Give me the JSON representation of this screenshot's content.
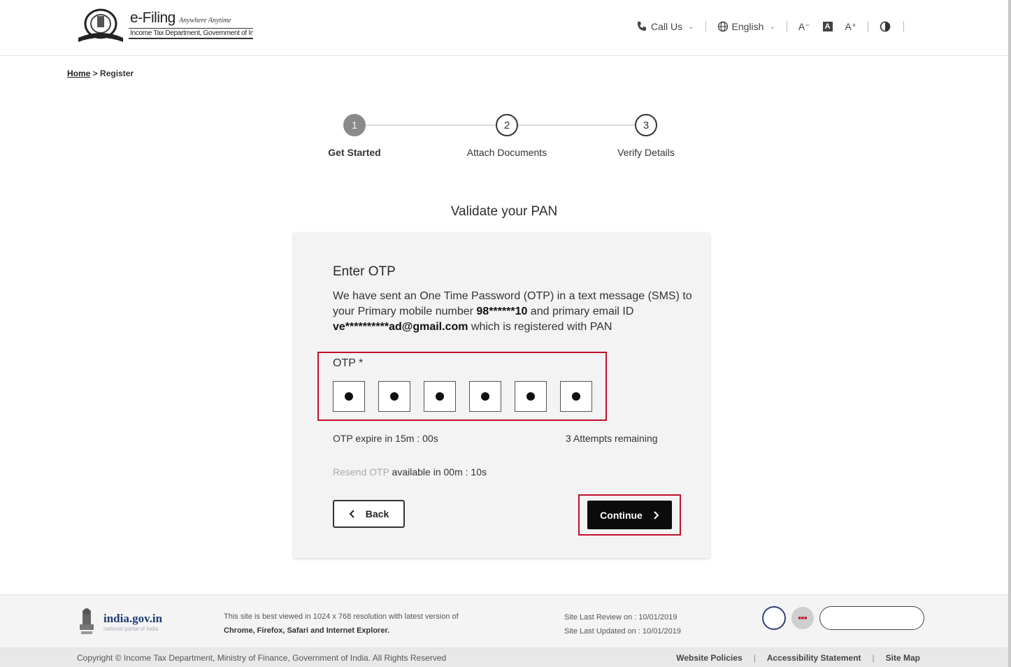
{
  "header": {
    "logo_main": "e-Filing",
    "logo_tagline": "Anywhere Anytime",
    "logo_sub": "Income Tax Department, Government of India",
    "call_us": "Call Us",
    "language": "English",
    "font_decrease": "A⁻",
    "font_reset": "A",
    "font_increase": "A⁺"
  },
  "breadcrumb": {
    "home": "Home",
    "separator": ">",
    "current": "Register"
  },
  "stepper": {
    "steps": [
      {
        "number": "1",
        "label": "Get Started",
        "active": true
      },
      {
        "number": "2",
        "label": "Attach Documents",
        "active": false
      },
      {
        "number": "3",
        "label": "Verify Details",
        "active": false
      }
    ]
  },
  "page_heading": "Validate your PAN",
  "card": {
    "title": "Enter OTP",
    "message_part1": "We have sent an One Time Password (OTP) in a text message (SMS) to your Primary mobile number ",
    "mobile": "98******10",
    "message_part2": " and primary email ID ",
    "email": "ve**********ad@gmail.com",
    "message_part3": " which is registered with PAN",
    "otp_label": "OTP *",
    "otp_digits": [
      "●",
      "●",
      "●",
      "●",
      "●",
      "●"
    ],
    "expiry": "OTP expire in 15m : 00s",
    "attempts": "3 Attempts remaining",
    "resend_link": "Resend OTP",
    "resend_text": " available in 00m : 10s",
    "back_label": "Back",
    "continue_label": "Continue"
  },
  "footer": {
    "india_gov": "india.gov.in",
    "india_gov_sub": "national portal of india",
    "best_view_line1": "This site is best viewed in 1024 x 768 resolution with latest version of",
    "best_view_line2": "Chrome, Firefox, Safari and Internet Explorer.",
    "last_review": "Site Last Review on  :  10/01/2019",
    "last_updated": "Site Last Updated on  : 10/01/2019",
    "copyright": "Copyright © Income Tax Department, Ministry of Finance, Government of India. All Rights Reserved",
    "links": [
      "Website Policies",
      "Accessibility Statement",
      "Site Map"
    ]
  },
  "colors": {
    "highlight": "#c0102a",
    "primary_button": "#0b0b0b",
    "card_bg": "#f3f3f3",
    "step_active": "#8a8a8a"
  }
}
